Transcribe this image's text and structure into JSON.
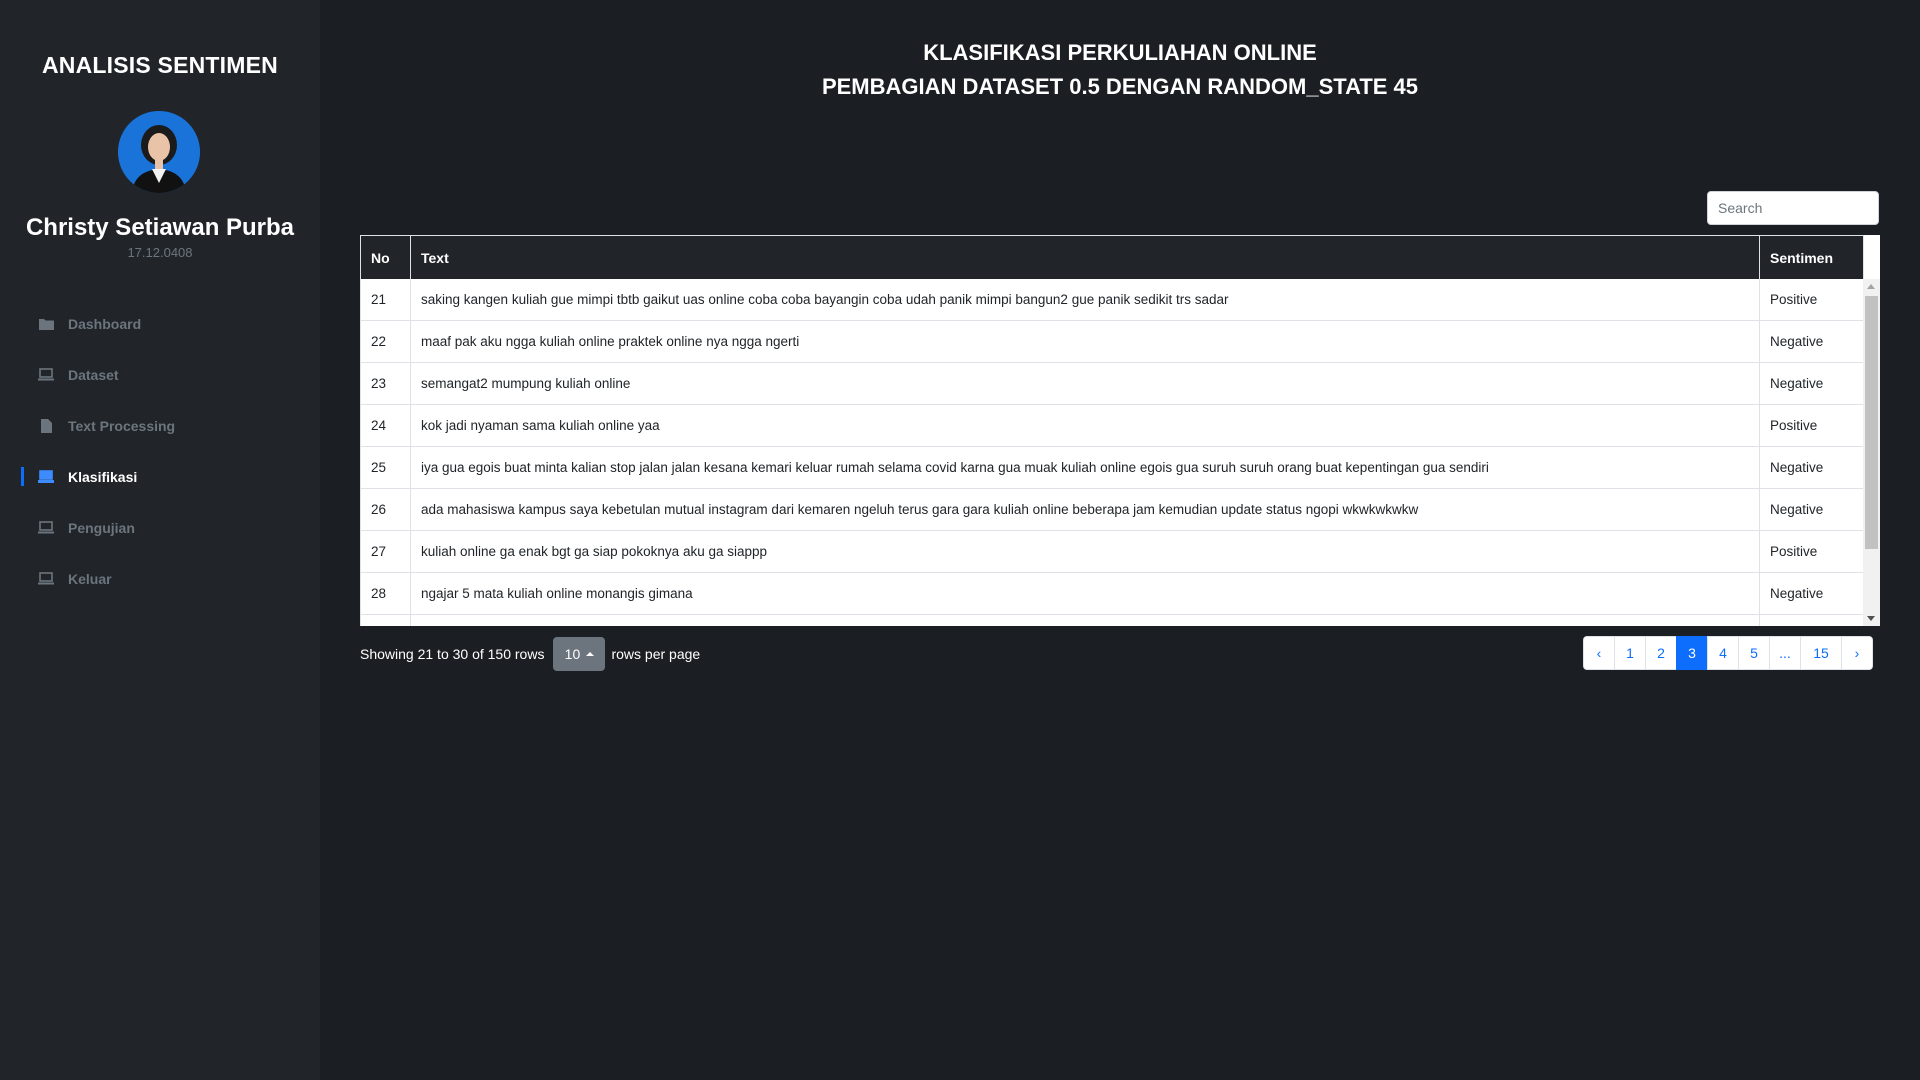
{
  "sidebar": {
    "brand": "ANALISIS SENTIMEN",
    "user_name": "Christy Setiawan Purba",
    "user_id": "17.12.0408",
    "items": [
      {
        "label": "Dashboard",
        "icon": "folder-icon"
      },
      {
        "label": "Dataset",
        "icon": "laptop-icon"
      },
      {
        "label": "Text Processing",
        "icon": "file-icon"
      },
      {
        "label": "Klasifikasi",
        "icon": "laptop-icon",
        "active": true
      },
      {
        "label": "Pengujian",
        "icon": "laptop-icon"
      },
      {
        "label": "Keluar",
        "icon": "laptop-icon"
      }
    ]
  },
  "header": {
    "title": "KLASIFIKASI PERKULIAHAN ONLINE",
    "subtitle": "PEMBAGIAN DATASET 0.5 DENGAN RANDOM_STATE 45"
  },
  "search": {
    "placeholder": "Search"
  },
  "table": {
    "columns": [
      "No",
      "Text",
      "Sentimen"
    ],
    "rows": [
      {
        "no": "21",
        "text": "saking kangen kuliah gue mimpi tbtb gaikut uas online coba coba bayangin coba udah panik mimpi bangun2 gue panik sedikit trs sadar",
        "sentimen": "Positive"
      },
      {
        "no": "22",
        "text": "maaf pak aku ngga kuliah online praktek online nya ngga ngerti",
        "sentimen": "Negative"
      },
      {
        "no": "23",
        "text": "semangat2 mumpung kuliah online",
        "sentimen": "Negative"
      },
      {
        "no": "24",
        "text": "kok jadi nyaman sama kuliah online yaa",
        "sentimen": "Positive"
      },
      {
        "no": "25",
        "text": "iya gua egois buat minta kalian stop jalan jalan kesana kemari keluar rumah selama covid karna gua muak kuliah online egois gua suruh suruh orang buat kepentingan gua sendiri",
        "sentimen": "Negative"
      },
      {
        "no": "26",
        "text": "ada mahasiswa kampus saya kebetulan mutual instagram dari kemaren ngeluh terus gara gara kuliah online beberapa jam kemudian update status ngopi wkwkwkwkw",
        "sentimen": "Negative"
      },
      {
        "no": "27",
        "text": "kuliah online ga enak bgt ga siap pokoknya aku ga siappp",
        "sentimen": "Positive"
      },
      {
        "no": "28",
        "text": "ngajar 5 mata kuliah online monangis gimana",
        "sentimen": "Negative"
      }
    ]
  },
  "footer": {
    "showing": "Showing 21 to 30 of 150 rows",
    "page_size": "10",
    "rows_per_page": "rows per page"
  },
  "pagination": {
    "prev": "‹",
    "pages": [
      "1",
      "2",
      "3",
      "4",
      "5",
      "...",
      "15"
    ],
    "active": "3",
    "next": "›"
  },
  "colors": {
    "background": "#1b1f23",
    "sidebar": "#212529",
    "accent": "#0d6efd",
    "muted": "#6c757d"
  }
}
